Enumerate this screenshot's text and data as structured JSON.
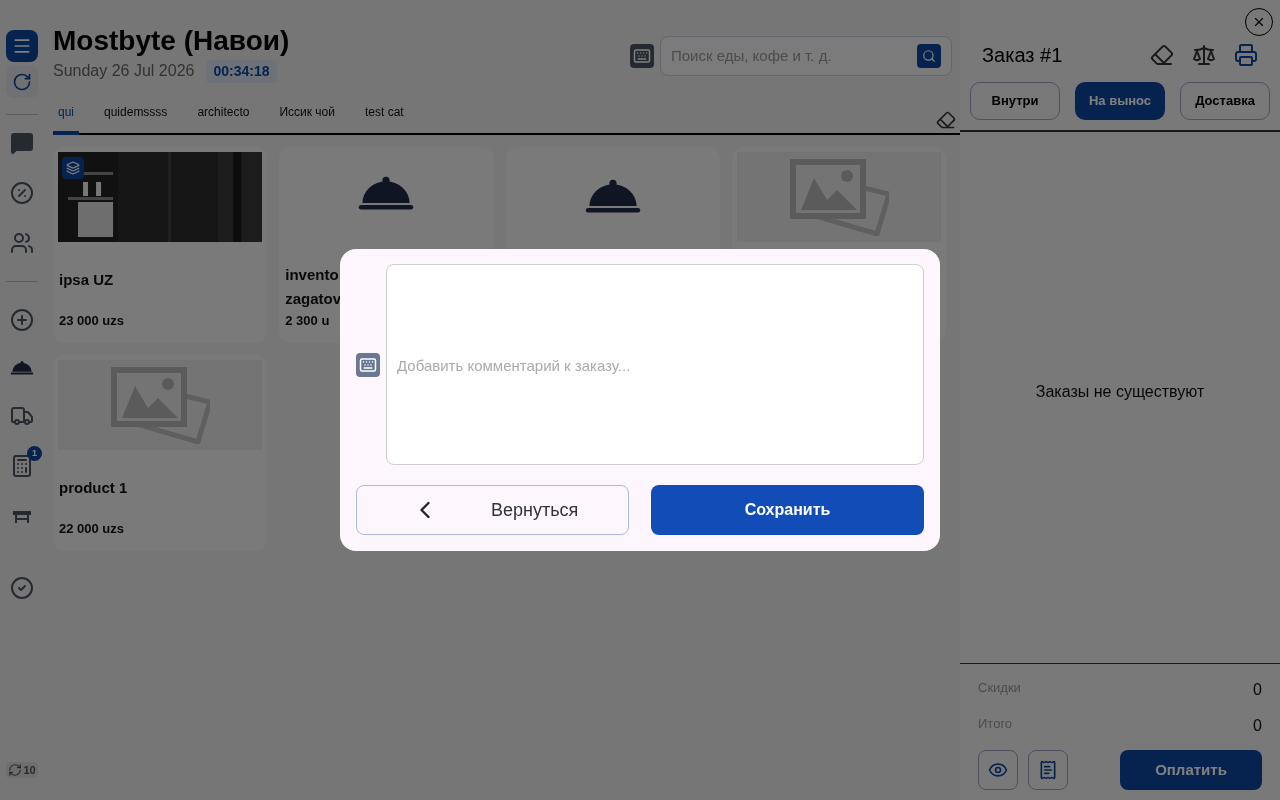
{
  "header": {
    "title": "Mostbyte (Навои)",
    "date": "Sunday 26 Jul 2026",
    "timer": "00:34:18"
  },
  "search": {
    "placeholder": "Поиск еды, кофе и т. д."
  },
  "sidebar": {
    "badge": "1",
    "sync_count": "10"
  },
  "categories": [
    {
      "label": "qui",
      "selected": true
    },
    {
      "label": "quidemssss",
      "selected": false
    },
    {
      "label": "architecto",
      "selected": false
    },
    {
      "label": "Иссик чой",
      "selected": false
    },
    {
      "label": "test cat",
      "selected": false
    }
  ],
  "products": [
    {
      "name_lines": [
        "ipsa UZ"
      ],
      "price": "23 000 uzs"
    },
    {
      "kind": "cloche",
      "name_lines": [
        "invento",
        "zagatov"
      ],
      "price": "2 300 u"
    },
    {
      "kind": "cloche"
    },
    {
      "kind": "placeholder"
    },
    {
      "kind": "placeholder",
      "name_lines": [
        "product 1"
      ],
      "price": "22 000 uzs"
    }
  ],
  "order": {
    "title": "Заказ #1",
    "types": [
      {
        "label": "Внутри",
        "selected": false
      },
      {
        "label": "На вынос",
        "selected": true
      },
      {
        "label": "Доставка",
        "selected": false
      }
    ],
    "empty_text": "Заказы не существуют",
    "summary": [
      {
        "label": "Скидки",
        "value": "0"
      },
      {
        "label": "Итого",
        "value": "0"
      }
    ],
    "pay_button": "Оплатить"
  },
  "modal": {
    "placeholder": "Добавить комментарий к заказу...",
    "back_button": "Вернуться",
    "save_button": "Сохранить"
  }
}
